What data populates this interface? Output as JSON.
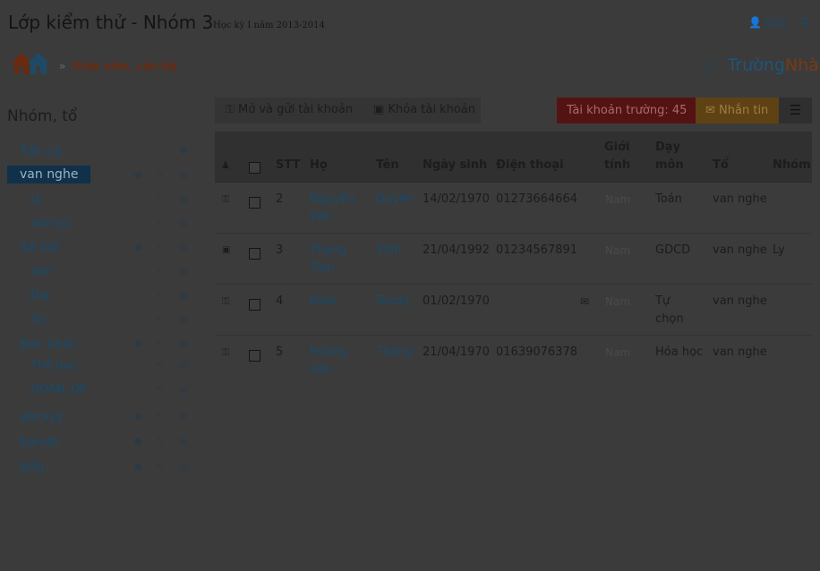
{
  "header": {
    "title": "Lớp kiểm thử - Nhóm 3",
    "subtitle": "Học kỳ I năm 2013-2014",
    "user_name": "Quý",
    "user_icon": "user-icon",
    "logout_icon": "sign-out-icon"
  },
  "breadcrumb": {
    "home_icon": "home-icon",
    "separator": "»",
    "current": "Giáo viên, cán bộ"
  },
  "brand": {
    "part1": "Trường",
    "part2": "Nhà",
    "icon": "chat-bubble-icon"
  },
  "sidebar": {
    "title": "Nhóm, tổ",
    "items": [
      {
        "label": "Tất cả"
      },
      {
        "label": "van nghe"
      },
      {
        "label": "Ly"
      },
      {
        "label": "abcxyz"
      },
      {
        "label": "Xã hội"
      },
      {
        "label": "Văn"
      },
      {
        "label": "Địa"
      },
      {
        "label": "Sử"
      },
      {
        "label": "Ban khác"
      },
      {
        "label": "Thể dục"
      },
      {
        "label": "GDAN_QP"
      },
      {
        "label": "abcxyz"
      },
      {
        "label": "bando"
      },
      {
        "label": "kjlkj"
      }
    ]
  },
  "toolbar": {
    "open_send": "Mở và gửi tài khoản",
    "lock": "Khóa tài khoản",
    "count": "Tài khoản trường: 45",
    "message": "Nhắn tin"
  },
  "table": {
    "headers": {
      "stt": "STT",
      "ho": "Họ",
      "ten": "Tên",
      "ngay_sinh": "Ngày sinh",
      "dien_thoai": "Điện thoại",
      "gioi_tinh_1": "Giới",
      "gioi_tinh_2": "tính",
      "day_mon_1": "Dạy",
      "day_mon_2": "môn",
      "to": "Tổ",
      "nhom": "Nhóm"
    },
    "rows": [
      {
        "status_icon": "key-icon",
        "stt": "2",
        "ho_1": "Nguyễn",
        "ho_2": "Văn",
        "ten": "Quyến",
        "ngay_sinh": "14/02/1970",
        "dien_thoai": "01273664664",
        "gioi_tinh": "Nam",
        "day_mon_1": "Toán",
        "day_mon_2": "",
        "to": "van nghe",
        "nhom": ""
      },
      {
        "status_icon": "lock-icon",
        "stt": "3",
        "ho_1": "Thang",
        "ho_2": "Tien",
        "ten": "Sinh",
        "ngay_sinh": "21/04/1992",
        "dien_thoai": "01234567891",
        "gioi_tinh": "Nam",
        "day_mon_1": "GDCD",
        "day_mon_2": "",
        "to": "van nghe",
        "nhom": "Ly"
      },
      {
        "status_icon": "key-icon",
        "stt": "4",
        "ho_1": "Kate",
        "ho_2": "",
        "ten": "Teddy",
        "ngay_sinh": "01/02/1970",
        "dien_thoai": "",
        "gioi_tinh": "Nam",
        "day_mon_1": "Tự",
        "day_mon_2": "chọn",
        "to": "van nghe",
        "nhom": ""
      },
      {
        "status_icon": "key-icon",
        "stt": "5",
        "ho_1": "Hoàng",
        "ho_2": "Văn",
        "ten": "Thắng",
        "ngay_sinh": "21/04/1970",
        "dien_thoai": "01639076378",
        "gioi_tinh": "Nam",
        "day_mon_1": "Hóa học",
        "day_mon_2": "",
        "to": "van nghe",
        "nhom": ""
      }
    ]
  },
  "colors": {
    "overlay_bg": "#3b3b3b",
    "selected_bg": "#103149",
    "count_bg": "#541313",
    "message_bg": "#5f4213"
  }
}
